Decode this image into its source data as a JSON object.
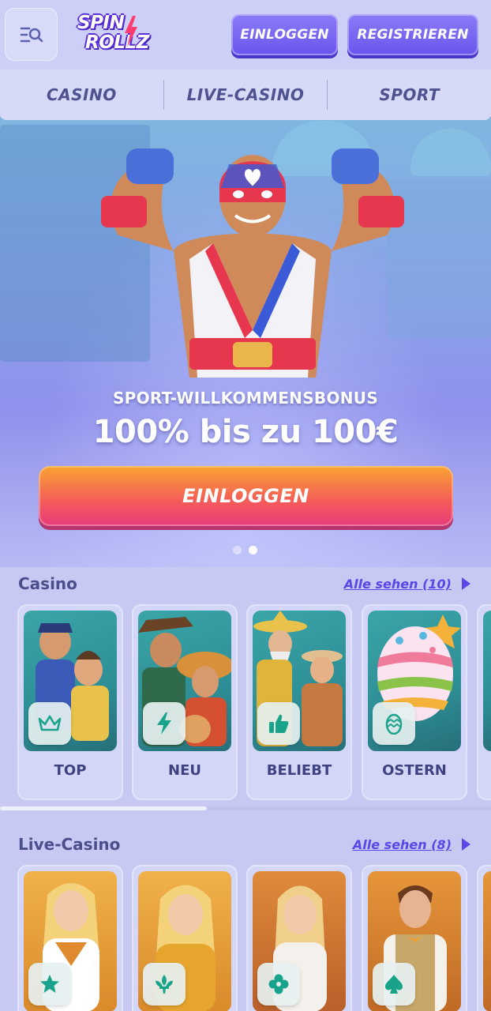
{
  "header": {
    "logo_line1": "SPIN",
    "logo_line2": "ROLLZ",
    "login_label": "EINLOGGEN",
    "register_label": "REGISTRIEREN"
  },
  "tabs": [
    {
      "label": "CASINO"
    },
    {
      "label": "LIVE-CASINO"
    },
    {
      "label": "SPORT"
    }
  ],
  "hero": {
    "subtitle": "SPORT-WILLKOMMENSBONUS",
    "title": "100% bis zu 100€",
    "cta_label": "EINLOGGEN",
    "slides_total": 2,
    "active_slide": 2
  },
  "casino": {
    "title": "Casino",
    "see_all": "Alle sehen (10)",
    "cards": [
      {
        "label": "TOP",
        "icon": "crown-icon"
      },
      {
        "label": "NEU",
        "icon": "lightning-icon"
      },
      {
        "label": "BELIEBT",
        "icon": "thumbs-up-icon"
      },
      {
        "label": "OSTERN",
        "icon": "easter-egg-icon"
      }
    ]
  },
  "live_casino": {
    "title": "Live-Casino",
    "see_all": "Alle sehen (8)",
    "cards": [
      {
        "icon": "star-icon"
      },
      {
        "icon": "fleur-de-lis-icon"
      },
      {
        "icon": "clover-icon"
      },
      {
        "icon": "spade-icon"
      }
    ]
  },
  "colors": {
    "accent": "#6a55ee",
    "cta_gradient_start": "#f9a431",
    "cta_gradient_end": "#e63c7a",
    "background": "#c7c9f3"
  }
}
